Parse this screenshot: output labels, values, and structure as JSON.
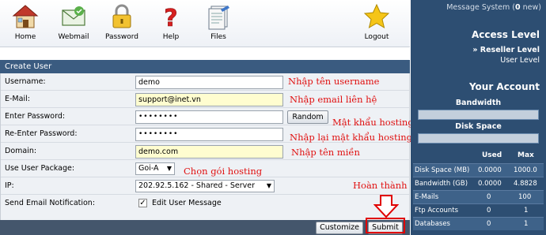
{
  "toolbar": {
    "items": [
      {
        "label": "Home",
        "icon": "house-icon"
      },
      {
        "label": "Webmail",
        "icon": "envelope-icon"
      },
      {
        "label": "Password",
        "icon": "padlock-icon"
      },
      {
        "label": "Help",
        "icon": "question-icon"
      },
      {
        "label": "Files",
        "icon": "document-icon"
      },
      {
        "label": "Logout",
        "icon": "star-icon"
      }
    ]
  },
  "form": {
    "title": "Create User",
    "username_label": "Username:",
    "username_value": "demo",
    "email_label": "E-Mail:",
    "email_value": "support@inet.vn",
    "password_label": "Enter Password:",
    "password_value": "••••••••",
    "random_button": "Random",
    "reenter_label": "Re-Enter Password:",
    "reenter_value": "••••••••",
    "domain_label": "Domain:",
    "domain_value": "demo.com",
    "package_label": "Use User Package:",
    "package_value": "Goi-A",
    "ip_label": "IP:",
    "ip_value": "202.92.5.162 - Shared - Server",
    "notify_label": "Send Email Notification:",
    "notify_checked": "✓",
    "edit_message": "Edit User Message",
    "customize_button": "Customize",
    "submit_button": "Submit"
  },
  "annotations": {
    "username": "Nhập tên username",
    "email": "Nhập email liên hệ",
    "password": "Mật khẩu hosting",
    "reenter": "Nhập lại mật khẩu hosting",
    "domain": "Nhập tên miền",
    "package": "Chọn gói hosting",
    "done": "Hoàn thành"
  },
  "sidebar": {
    "message_system_prefix": "Message System (",
    "message_count": "0",
    "message_system_suffix": " new)",
    "access_level_title": "Access Level",
    "reseller_level": "» Reseller Level",
    "user_level": "User Level",
    "your_account_title": "Your Account",
    "bandwidth_label": "Bandwidth",
    "disk_space_label": "Disk Space",
    "used_label": "Used",
    "max_label": "Max",
    "stats": [
      {
        "name": "Disk Space (MB)",
        "used": "0.0000",
        "max": "1000.0"
      },
      {
        "name": "Bandwidth (GB)",
        "used": "0.0000",
        "max": "4.8828"
      },
      {
        "name": "E-Mails",
        "used": "0",
        "max": "100"
      },
      {
        "name": "Ftp Accounts",
        "used": "0",
        "max": "1"
      },
      {
        "name": "Databases",
        "used": "0",
        "max": "1"
      }
    ]
  },
  "colors": {
    "sidebar_bg": "#2d4e72",
    "header_bg": "#3a5b80",
    "annotation_red": "#e01010"
  }
}
